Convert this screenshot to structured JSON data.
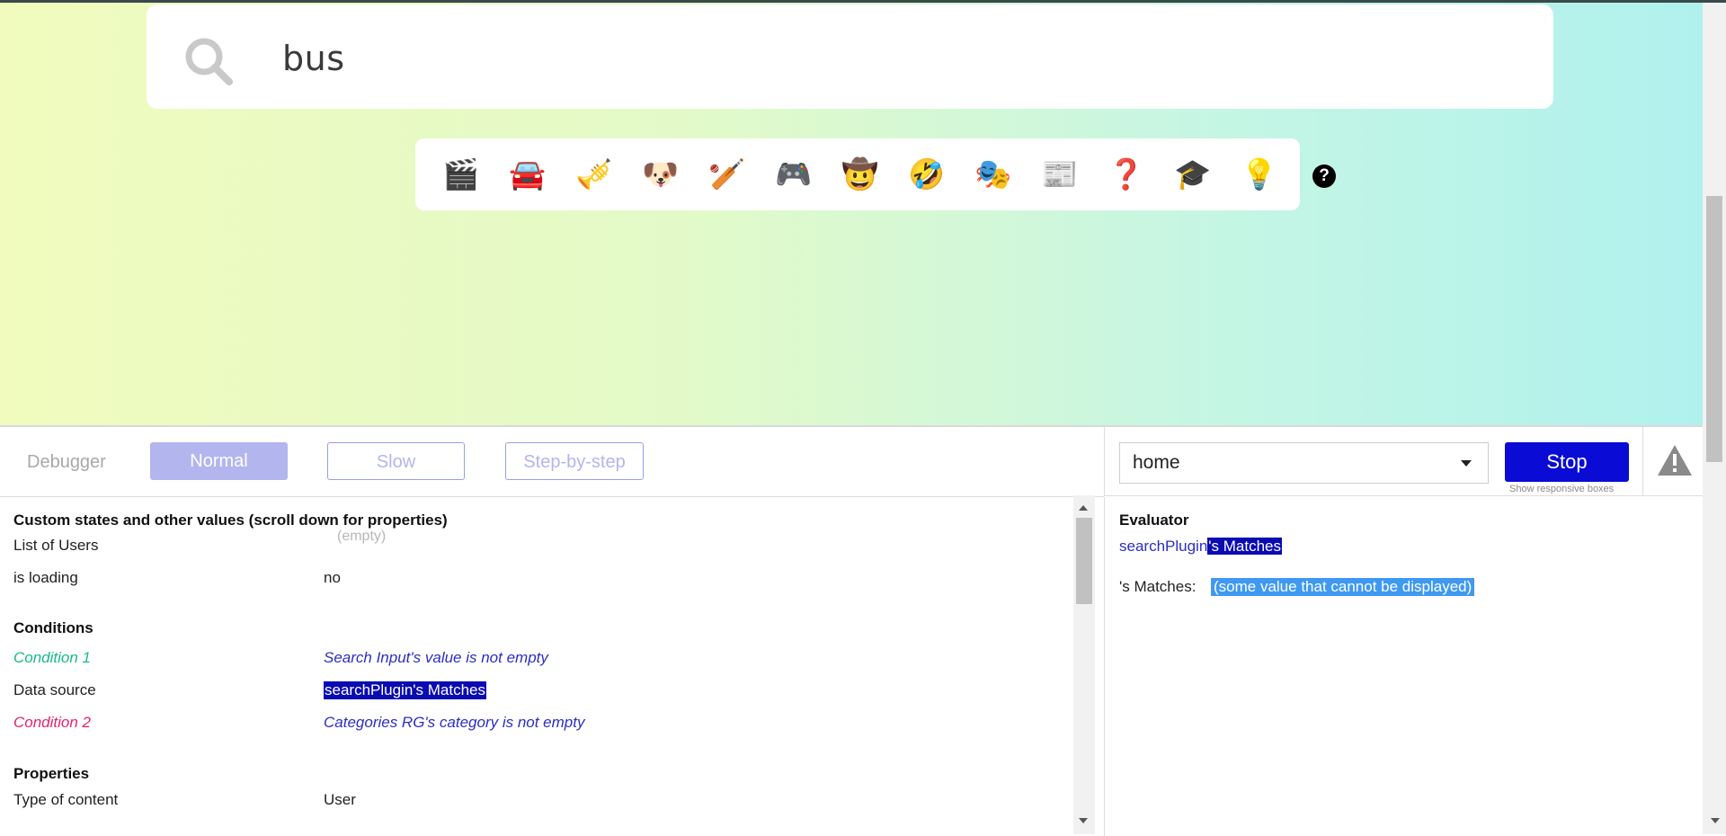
{
  "search": {
    "value": "bus"
  },
  "categories": [
    {
      "icon": "clapper-board-icon",
      "glyph": "🎬"
    },
    {
      "icon": "car-icon",
      "glyph": "🚘"
    },
    {
      "icon": "trumpet-icon",
      "glyph": "🎺"
    },
    {
      "icon": "dog-face-icon",
      "glyph": "🐶"
    },
    {
      "icon": "cricket-bat-icon",
      "glyph": "🏏"
    },
    {
      "icon": "game-controller-icon",
      "glyph": "🎮"
    },
    {
      "icon": "cowboy-face-icon",
      "glyph": "🤠"
    },
    {
      "icon": "rofl-face-icon",
      "glyph": "🤣"
    },
    {
      "icon": "theater-masks-icon",
      "glyph": "🎭"
    },
    {
      "icon": "newspaper-icon",
      "glyph": "📰"
    },
    {
      "icon": "question-mark-icon",
      "glyph": "❓"
    },
    {
      "icon": "graduation-cap-icon",
      "glyph": "🎓"
    },
    {
      "icon": "light-bulb-icon",
      "glyph": "💡"
    }
  ],
  "help": {
    "glyph": "?"
  },
  "debugger": {
    "title": "Debugger",
    "modes": {
      "normal": "Normal",
      "slow": "Slow",
      "step": "Step-by-step"
    },
    "page_select": "home",
    "stop_label": "Stop",
    "responsive_label": "Show responsive boxes"
  },
  "inspector": {
    "custom_states_header": "Custom states and other values (scroll down for properties)",
    "list_of_users_label": "List of Users",
    "list_of_users_value": "(empty)",
    "is_loading_label": "is loading",
    "is_loading_value": "no",
    "conditions_header": "Conditions",
    "condition1_label": "Condition 1",
    "condition1_value": "Search Input's value is not empty",
    "data_source_label": "Data source",
    "data_source_value": "searchPlugin's Matches",
    "condition2_label": "Condition 2",
    "condition2_value": "Categories RG's category is not empty",
    "properties_header": "Properties",
    "type_of_content_label": "Type of content",
    "type_of_content_value": "User"
  },
  "evaluator": {
    "title": "Evaluator",
    "expr_plugin": "searchPlugin",
    "expr_field": "'s Matches",
    "result_label": "'s Matches:",
    "result_value": "(some value that cannot be displayed)"
  }
}
